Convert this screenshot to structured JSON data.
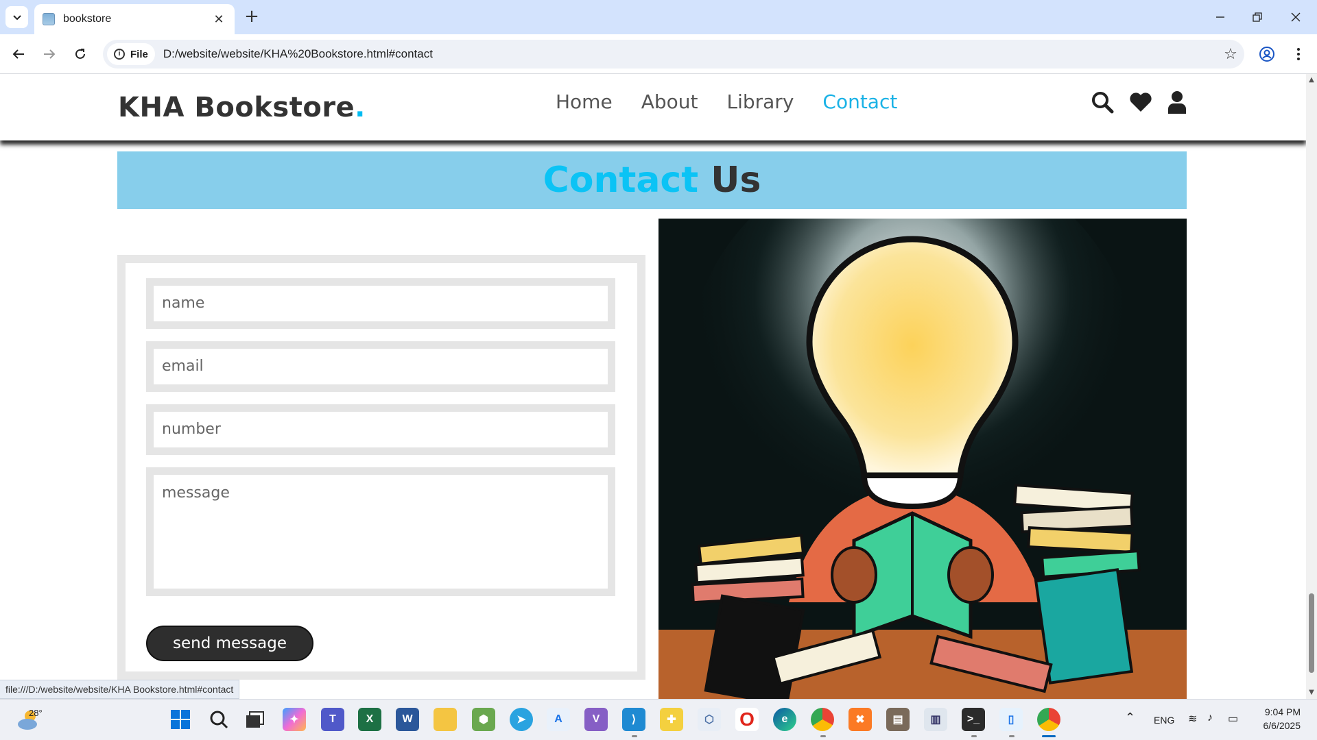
{
  "browser": {
    "tab_title": "bookstore",
    "site_chip": "File",
    "url": "D:/website/website/KHA%20Bookstore.html#contact",
    "status_url": "file:///D:/website/website/KHA Bookstore.html#contact"
  },
  "site": {
    "logo_text": "KHA Bookstore",
    "logo_dot": ".",
    "nav": [
      "Home",
      "About",
      "Library",
      "Contact"
    ],
    "active_nav": "Contact",
    "accent_color": "#1ab2e6",
    "header_icons": [
      "search-icon",
      "heart-icon",
      "user-icon"
    ]
  },
  "contact": {
    "title_highlight": "Contact",
    "title_rest": "Us",
    "banner_color": "#87ceeb",
    "fields": {
      "name": "name",
      "email": "email",
      "number": "number",
      "message": "message"
    },
    "button_label": "send message"
  },
  "taskbar": {
    "weather_temp": "28°",
    "language": "ENG",
    "time": "9:04 PM",
    "date": "6/6/2025"
  }
}
